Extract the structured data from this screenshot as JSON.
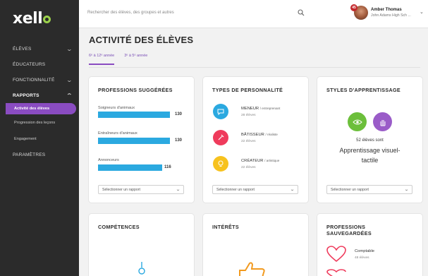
{
  "app": {
    "logo": "xello"
  },
  "sidebar": {
    "items": [
      {
        "label": "ÉLÈVES",
        "chevron": "⌄"
      },
      {
        "label": "ÉDUCATEURS",
        "chevron": ""
      },
      {
        "label": "FONCTIONNALITÉ",
        "chevron": "⌄"
      },
      {
        "label": "RAPPORTS",
        "chevron": "⌃"
      }
    ],
    "subitems": [
      {
        "label": "Activité des élèves"
      },
      {
        "label": "Progression des leçons"
      },
      {
        "label": "Engagement"
      }
    ],
    "settings": "PARAMÈTRES"
  },
  "topbar": {
    "search_placeholder": "Rechercher des élèves, des groupes et autres",
    "notification_count": "45",
    "user_name": "Amber Thomas",
    "user_school": "John Adams High Sch ..."
  },
  "main": {
    "title": "ACTIVITÉ DES ÉLÈVES",
    "tabs": [
      {
        "label": "6ᵉ à 12ᵉ année"
      },
      {
        "label": "3ᵉ à 5ᵉ année"
      }
    ]
  },
  "select_label": "Sélectionner un rapport",
  "professions": {
    "title": "PROFESSIONS SUGGÉRÉES",
    "items": [
      {
        "label": "Soigneurs d'animaux",
        "value": 130
      },
      {
        "label": "Entraîneurs d'animaux",
        "value": 130
      },
      {
        "label": "Annonceurs",
        "value": 116
      }
    ],
    "max": 130
  },
  "personality": {
    "title": "TYPES DE PERSONNALITÉ",
    "items": [
      {
        "name": "MENEUR",
        "qualifier": "/ entreprenant",
        "count": "28 élèves",
        "color": "#2ba9e0"
      },
      {
        "name": "BÂTISSEUR",
        "qualifier": "/ réaliste",
        "count": "22 élèves",
        "color": "#ef3b5c"
      },
      {
        "name": "CRÉATEUR",
        "qualifier": "/ artistique",
        "count": "22 élèves",
        "color": "#f7c21e"
      }
    ]
  },
  "learning": {
    "title": "STYLES D'APPRENTISSAGE",
    "count_text": "52 élèves sont",
    "style_line1": "Apprentissage visuel-",
    "style_line2": "tactile",
    "colors": [
      "#6cbf3b",
      "#9a5cc8"
    ]
  },
  "competences": {
    "title": "COMPÉTENCES"
  },
  "interets": {
    "title": "INTÉRÊTS"
  },
  "saved": {
    "title_line1": "PROFESSIONS",
    "title_line2": "SAUVEGARDÉES",
    "item_label": "Comptable",
    "item_count": "48 élèves"
  }
}
